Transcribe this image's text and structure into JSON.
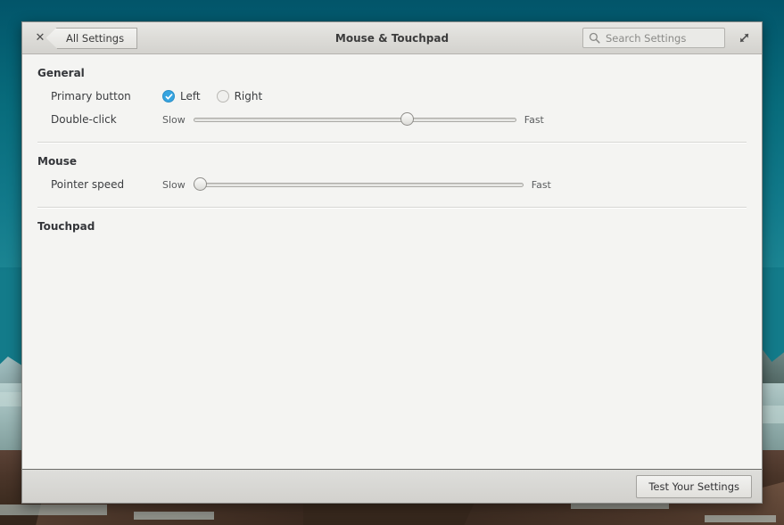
{
  "window": {
    "title": "Mouse & Touchpad",
    "close_label": "✕",
    "back_label": "All Settings",
    "close_icon": "close-icon",
    "back_icon": "chevron-left-icon",
    "maximize_icon": "maximize-icon"
  },
  "search": {
    "placeholder": "Search Settings",
    "value": "",
    "icon": "search-icon"
  },
  "sections": {
    "general": {
      "title": "General",
      "primary_button": {
        "label": "Primary button",
        "options": [
          {
            "label": "Left",
            "selected": true
          },
          {
            "label": "Right",
            "selected": false
          }
        ]
      },
      "double_click": {
        "label": "Double-click",
        "min_label": "Slow",
        "max_label": "Fast",
        "value_percent": 67
      }
    },
    "mouse": {
      "title": "Mouse",
      "pointer_speed": {
        "label": "Pointer speed",
        "min_label": "Slow",
        "max_label": "Fast",
        "value_percent": 0
      }
    },
    "touchpad": {
      "title": "Touchpad"
    }
  },
  "footer": {
    "test_button": "Test Your Settings"
  },
  "colors": {
    "accent": "#36a4e0",
    "window_bg": "#f4f4f2",
    "titlebar_bg": "#dddcd8",
    "desktop_teal": "#0a6878"
  }
}
